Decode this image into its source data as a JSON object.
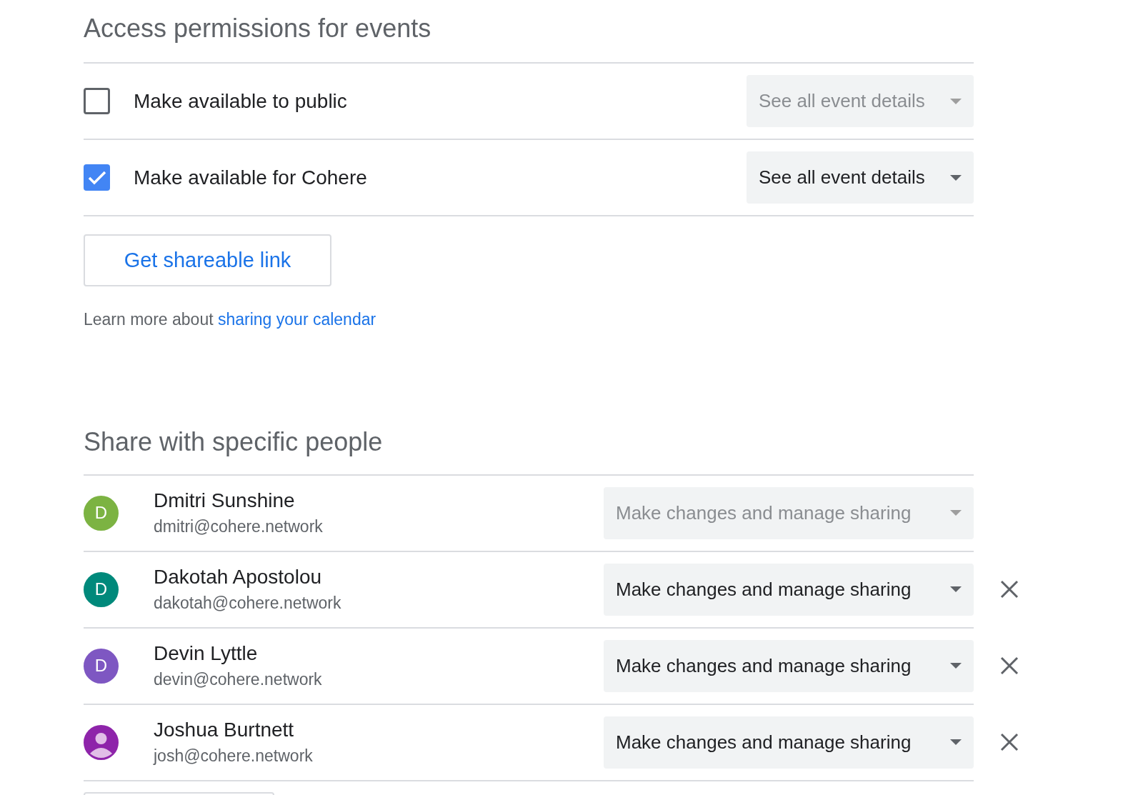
{
  "access": {
    "title": "Access permissions for events",
    "options": [
      {
        "label": "Make available to public",
        "checked": false,
        "dropdown": {
          "value": "See all event details",
          "disabled": true
        }
      },
      {
        "label": "Make available for Cohere",
        "checked": true,
        "dropdown": {
          "value": "See all event details",
          "disabled": false
        }
      }
    ],
    "link_button": "Get shareable link",
    "learn_more": {
      "text": "Learn more about",
      "link": "sharing your calendar"
    }
  },
  "share": {
    "title": "Share with specific people",
    "people": [
      {
        "name": "Dmitri Sunshine",
        "email": "dmitri@cohere.network",
        "avatar": {
          "kind": "letter",
          "letter": "D",
          "color": "#7cb342"
        },
        "permission": {
          "value": "Make changes and manage sharing",
          "disabled": true
        },
        "removable": false
      },
      {
        "name": "Dakotah Apostolou",
        "email": "dakotah@cohere.network",
        "avatar": {
          "kind": "letter",
          "letter": "D",
          "color": "#00897b"
        },
        "permission": {
          "value": "Make changes and manage sharing",
          "disabled": false
        },
        "removable": true
      },
      {
        "name": "Devin Lyttle",
        "email": "devin@cohere.network",
        "avatar": {
          "kind": "letter",
          "letter": "D",
          "color": "#7e57c2"
        },
        "permission": {
          "value": "Make changes and manage sharing",
          "disabled": false
        },
        "removable": true
      },
      {
        "name": "Joshua Burtnett",
        "email": "josh@cohere.network",
        "avatar": {
          "kind": "silhouette",
          "color": "#8e24aa"
        },
        "permission": {
          "value": "Make changes and manage sharing",
          "disabled": false
        },
        "removable": true
      }
    ]
  }
}
